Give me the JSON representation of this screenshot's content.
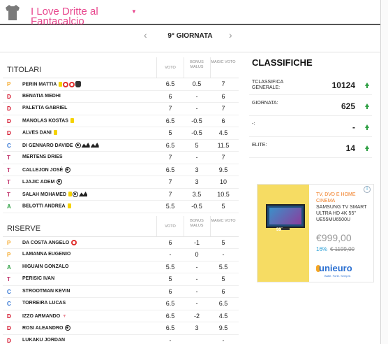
{
  "team": {
    "name": "I Love Dritte al Fantacalcio"
  },
  "round": {
    "label": "9° GIORNATA",
    "prev": "‹",
    "next": "›"
  },
  "columns": {
    "vote": "VOTO",
    "bonus": "BONUS MALUS",
    "magic": "MAGIC VOTO"
  },
  "starters": {
    "title": "TITOLARI",
    "rows": [
      {
        "role": "P",
        "name": "PERIN MATTIA",
        "badges": [
          "yellow-card-icon",
          "penalty-saved-icon",
          "penalty-saved-icon",
          "glove-icon"
        ],
        "vote": "6.5",
        "bonus": "0.5",
        "magic": "7"
      },
      {
        "role": "D",
        "name": "BENATIA MEDHI",
        "badges": [],
        "vote": "6",
        "bonus": "-",
        "magic": "6"
      },
      {
        "role": "D",
        "name": "PALETTA GABRIEL",
        "badges": [],
        "vote": "7",
        "bonus": "-",
        "magic": "7"
      },
      {
        "role": "D",
        "name": "MANOLAS KOSTAS",
        "badges": [
          "yellow-card-icon"
        ],
        "vote": "6.5",
        "bonus": "-0.5",
        "magic": "6"
      },
      {
        "role": "D",
        "name": "ALVES DANI",
        "badges": [
          "yellow-card-icon"
        ],
        "vote": "5",
        "bonus": "-0.5",
        "magic": "4.5"
      },
      {
        "role": "C",
        "name": "DI GENNARO DAVIDE",
        "badges": [
          "goal-icon",
          "assist-icon",
          "assist-icon"
        ],
        "vote": "6.5",
        "bonus": "5",
        "magic": "11.5"
      },
      {
        "role": "T",
        "name": "MERTENS DRIES",
        "badges": [],
        "vote": "7",
        "bonus": "-",
        "magic": "7"
      },
      {
        "role": "T",
        "name": "CALLEJON JOSÉ",
        "badges": [
          "goal-icon"
        ],
        "vote": "6.5",
        "bonus": "3",
        "magic": "9.5"
      },
      {
        "role": "T",
        "name": "LJAJIC ADEM",
        "badges": [
          "goal-icon"
        ],
        "vote": "7",
        "bonus": "3",
        "magic": "10"
      },
      {
        "role": "T",
        "name": "SALAH MOHAMED",
        "badges": [
          "yellow-card-icon",
          "goal-icon",
          "assist-icon"
        ],
        "vote": "7",
        "bonus": "3.5",
        "magic": "10.5"
      },
      {
        "role": "A",
        "name": "BELOTTI ANDREA",
        "badges": [
          "yellow-card-icon"
        ],
        "vote": "5.5",
        "bonus": "-0.5",
        "magic": "5"
      }
    ]
  },
  "reserves": {
    "title": "RISERVE",
    "rows": [
      {
        "role": "P",
        "name": "DA COSTA ANGELO",
        "badges": [
          "penalty-saved-icon"
        ],
        "vote": "6",
        "bonus": "-1",
        "magic": "5"
      },
      {
        "role": "P",
        "name": "LAMANNA EUGENIO",
        "badges": [],
        "vote": "-",
        "bonus": "0",
        "magic": "-"
      },
      {
        "role": "A",
        "name": "HIGUAIN GONZALO",
        "badges": [],
        "vote": "5.5",
        "bonus": "-",
        "magic": "5.5"
      },
      {
        "role": "T",
        "name": "PERISIC IVAN",
        "badges": [],
        "vote": "5",
        "bonus": "-",
        "magic": "5"
      },
      {
        "role": "C",
        "name": "STROOTMAN KEVIN",
        "badges": [],
        "vote": "6",
        "bonus": "-",
        "magic": "6"
      },
      {
        "role": "C",
        "name": "TORREIRA LUCAS",
        "badges": [],
        "vote": "6.5",
        "bonus": "-",
        "magic": "6.5"
      },
      {
        "role": "D",
        "name": "IZZO ARMANDO",
        "badges": [
          "trophy-icon"
        ],
        "vote": "6.5",
        "bonus": "-2",
        "magic": "4.5"
      },
      {
        "role": "D",
        "name": "ROSI ALEANDRO",
        "badges": [
          "goal-icon"
        ],
        "vote": "6.5",
        "bonus": "3",
        "magic": "9.5"
      },
      {
        "role": "D",
        "name": "LUKAKU JORDAN",
        "badges": [],
        "vote": "-",
        "bonus": "",
        "magic": "-"
      }
    ]
  },
  "rankings": {
    "title": "CLASSIFICHE",
    "rows": [
      {
        "label": "TCLASSIFICA GENERALE:",
        "value": "10124"
      },
      {
        "label": "GIORNATA:",
        "value": "625"
      },
      {
        "label": "-:",
        "value": "-"
      },
      {
        "label": "ELITE:",
        "value": "14"
      }
    ]
  },
  "ad": {
    "headline": "TV, DVD E HOME CINEMA",
    "description": "SAMSUNG TV SMART ULTRA HD 4K 55\" UE55MU6500U",
    "price": "€999,00",
    "discount": "16%",
    "old_price": "€ 1199,00",
    "brand": "unieuro",
    "tagline": "Batte. Forte. Sempre.",
    "tv_size": "55\"",
    "info": "i"
  },
  "colors": {
    "accent": "#e8468d",
    "up": "#2ea043",
    "goalkeeper": "#f5a623",
    "defender": "#d0021b",
    "midfielder": "#2a6fd1",
    "forward": "#2ea043"
  }
}
